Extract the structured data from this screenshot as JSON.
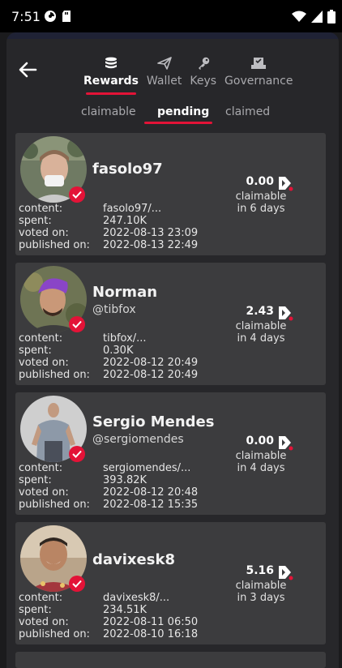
{
  "status_bar": {
    "time": "7:51",
    "icons_left": [
      "sync-icon",
      "sd-card-icon"
    ],
    "icons_right": [
      "wifi-icon",
      "signal-icon",
      "battery-icon"
    ]
  },
  "nav": {
    "back_icon": "back-arrow-icon",
    "tabs": [
      {
        "label": "Rewards",
        "icon": "coins-icon",
        "active": true
      },
      {
        "label": "Wallet",
        "icon": "send-icon",
        "active": false
      },
      {
        "label": "Keys",
        "icon": "key-icon",
        "active": false
      },
      {
        "label": "Governance",
        "icon": "ballot-icon",
        "active": false
      }
    ]
  },
  "sub_tabs": [
    {
      "label": "claimable",
      "active": false
    },
    {
      "label": "pending",
      "active": true
    },
    {
      "label": "claimed",
      "active": false
    }
  ],
  "field_labels": {
    "content": "content:",
    "spent": "spent:",
    "voted": "voted on:",
    "published": "published on:"
  },
  "colors": {
    "accent": "#e31337",
    "card": "#3c3c3e",
    "background": "#27272a"
  },
  "rewards": [
    {
      "name": "fasolo97",
      "handle": "",
      "amount": "0.00",
      "status": "claimable",
      "eta": "in 6 days",
      "content": "fasolo97/...",
      "spent": "247.10K",
      "voted_on": "2022-08-13 23:09",
      "published_on": "2022-08-13 22:49"
    },
    {
      "name": "Norman",
      "handle": "@tibfox",
      "amount": "2.43",
      "status": "claimable",
      "eta": "in 4 days",
      "content": "tibfox/...",
      "spent": "0.30K",
      "voted_on": "2022-08-12 20:49",
      "published_on": "2022-08-12 20:49"
    },
    {
      "name": "Sergio Mendes",
      "handle": "@sergiomendes",
      "amount": "0.00",
      "status": "claimable",
      "eta": "in 4 days",
      "content": "sergiomendes/...",
      "spent": "393.82K",
      "voted_on": "2022-08-12 20:48",
      "published_on": "2022-08-12 15:35"
    },
    {
      "name": "davixesk8",
      "handle": "",
      "amount": "5.16",
      "status": "claimable",
      "eta": "in 3 days",
      "content": "davixesk8/...",
      "spent": "234.51K",
      "voted_on": "2022-08-11 06:50",
      "published_on": "2022-08-10 16:18"
    }
  ]
}
